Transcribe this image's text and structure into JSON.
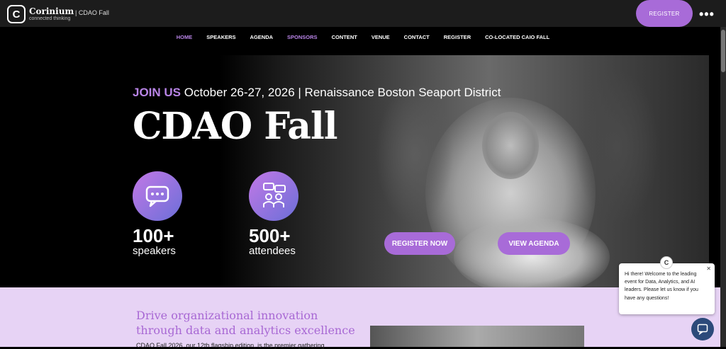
{
  "header": {
    "logo_name": "Corinium",
    "logo_tagline": "connected thinking",
    "event_label": "| CDAO Fall",
    "register_label": "REGISTER",
    "more_label": "•••"
  },
  "nav": {
    "items": [
      {
        "label": "HOME",
        "active": true
      },
      {
        "label": "SPEAKERS",
        "active": false
      },
      {
        "label": "AGENDA",
        "active": false
      },
      {
        "label": "SPONSORS",
        "active": true
      },
      {
        "label": "CONTENT",
        "active": false
      },
      {
        "label": "VENUE",
        "active": false
      },
      {
        "label": "CONTACT",
        "active": false
      },
      {
        "label": "REGISTER",
        "active": false
      },
      {
        "label": "CO-LOCATED CAIO FALL",
        "active": false
      }
    ]
  },
  "hero": {
    "join_prefix": "JOIN US",
    "join_details": " October 26-27, 2026 | Renaissance Boston Seaport District",
    "title": "CDAO Fall",
    "stats": [
      {
        "number": "100+",
        "label": "speakers",
        "icon": "chat-bubble-icon"
      },
      {
        "number": "500+",
        "label": "attendees",
        "icon": "people-conversation-icon"
      }
    ],
    "register_now_label": "REGISTER NOW",
    "view_agenda_label": "VIEW AGENDA"
  },
  "lower": {
    "heading": "Drive organizational innovation through data and analytics excellence",
    "body_start": "CDAO Fall 2026, our 12th flagship edition, is the premier gathering"
  },
  "chat": {
    "message": "Hi there! Welcome to the leading event for Data, Analytics, and AI leaders. Please let us know if you have any questions!",
    "close_label": "✕",
    "avatar_letter": "C"
  },
  "colors": {
    "accent": "#a86bd8",
    "accent_light": "#b884e6",
    "lower_bg": "#e7d3f5"
  }
}
